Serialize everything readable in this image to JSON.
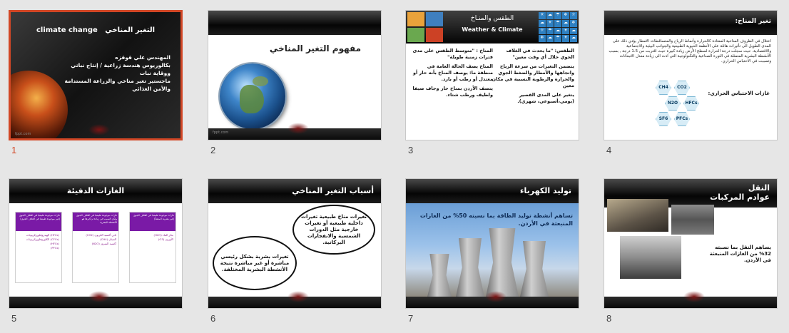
{
  "app": {
    "view": "Slide Sorter"
  },
  "selected_slide": 1,
  "slides": [
    {
      "number": "1",
      "title_ar": "التغير المناخي",
      "title_en": "climate change",
      "body_lines": [
        "المهندس علي قوقزه",
        "بكالوريوس هندسة زراعية / إنتاج نباتي",
        "ووقاية نبات",
        "ماجستير تغير مناخي والزراعة المستدامة",
        "والأمن الغذائي"
      ],
      "footer": "fppt.com"
    },
    {
      "number": "2",
      "title": "مفهوم التغير المناخي",
      "footer": "fppt.com"
    },
    {
      "number": "3",
      "title_ar": "الطقس والمنـاخ",
      "title_en": "Weather & Climate",
      "right_col": [
        "الطقس: \"ما يحدث في الغلاف الجوي خلال أي وقت معين\"",
        "يتضمن التغيرات من سرعة الرياح واتجاهها والأمطار والضغط الجوي والحرارة والرطوبة النسبية في مكان معين",
        "يتغير على المدى القصير (يومي،أسبوعي، شهري)."
      ],
      "left_col": [
        "المناخ : \"متوسط الطقس على مدى فترات زمنية طويلة\"",
        "المناخ يصف الحالة العامة في منطقة ما: يوصف المناخ بأنه حار أو معتدل أو رطب أو بارد.",
        "يتصف الأردن بمناخ حار وجاف صيفا ولطيف ورطب شتاء."
      ]
    },
    {
      "number": "4",
      "title": "تغير المناخ:",
      "body": "اختلال في الظروف المناخية المعتادة كالحرارة وأنماط الرياح والمتساقطات الامطار يؤدي ذلك على المدى الطويل الى تأثيرات هائلة على الأنظمة الحيوية الطبيعية والجوانب البيئية والاجتماعية والاقتصادية. حيث سجلت درجة الحرارة لسطح الأرض زيادة كبيرة حيث اقتربت من 1.5 درجة , بسبب الأنشطة البشرية المتمثلة في الثورة الصناعية والتكنولوجية التي ادت الى زيادة معدل الانبعاثات وتسببت في الاحتباس الحراري.",
      "subtitle": "غازات الاحتباس الحراري:",
      "gases": [
        "CH4",
        "CO2",
        "N2O",
        "HFCs",
        "SF6",
        "PFCs"
      ]
    },
    {
      "number": "5",
      "title": "الغازات الدفيئة",
      "boxes": [
        {
          "head": "غازات موجودة طبيعيا في الغلاف الجوي (غير موجودة طبيعيا في الغلاف الجوي)",
          "items": [
            "(HFCs) الهيدروفلوروكربونات",
            "(CFCs) الكلوروفلوروكربونات",
            "(HFCs)",
            "(PFCs)"
          ]
        },
        {
          "head": "غازات موجودة طبيعيا في الغلاف الجوي ولكن السبب في زيادة تراكيزها هو الأنشطة البشرية",
          "items": [
            "ثاني أكسيد الكربون (CO2)",
            "الميثان (CH4)",
            "أكسيد النيتروز (N2O)"
          ]
        },
        {
          "head": "غازات موجودة طبيعيا في الغلاف الجوي (غير بشرية المنشأ)",
          "items": [
            "بخار الماء (H2O)",
            "الأوزون (O3)"
          ]
        }
      ]
    },
    {
      "number": "6",
      "title": "أسباب التغير المناخي",
      "oval_natural": "تغيرات مناخ طبيعية تغيرات داخلية طبيعية أو تغيرات خارجية مثل الدورات الشمسية والانفجارات البركانية.",
      "oval_human": "تغيرات بشرية بشكل رئيسي مباشرة أو غير مباشرة نتيجة الأنشطة البشرية المختلفة."
    },
    {
      "number": "7",
      "title": "توليد الكهرباء",
      "text": "تساهم أنشطة توليد الطاقة بما نسبته 50% من الغازات المنبعثة في الأردن."
    },
    {
      "number": "8",
      "title_line1": "النقل",
      "title_line2": "عوادم المركبات",
      "text": "يساهم النقل بما نسبته 32% من الغازات المنبعثة في الأردن."
    }
  ]
}
